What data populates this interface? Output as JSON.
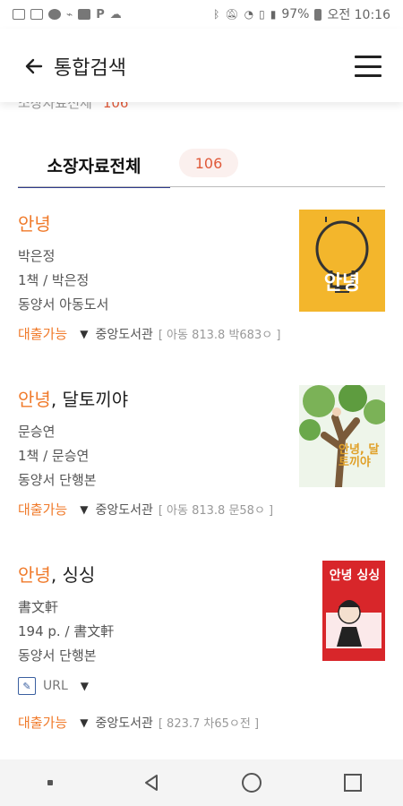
{
  "status_bar": {
    "battery": "97%",
    "time_label": "오전 10:16"
  },
  "app_bar": {
    "title": "통합검색",
    "back_icon": "arrow-left-icon",
    "menu_icon": "hamburger-menu-icon"
  },
  "peek_header": {
    "label": "소장자료전체",
    "count": "106"
  },
  "tabs": [
    {
      "label": "소장자료전체",
      "count": "106",
      "active": true
    }
  ],
  "books": [
    {
      "title_highlight": "안녕",
      "title_rest": "",
      "author": "박은정",
      "volume": "1책 / 박은정",
      "location_type": "동양서 아동도서",
      "availability": "대출가능",
      "library": "중앙도서관",
      "call_number": "[ 아동 813.8 박683ㅇ ]",
      "cover_text": "안녕"
    },
    {
      "title_highlight": "안녕",
      "title_rest": ", 달토끼야",
      "author": "문승연",
      "volume": "1책 / 문승연",
      "location_type": "동양서 단행본",
      "availability": "대출가능",
      "library": "중앙도서관",
      "call_number": "[ 아동 813.8 문58ㅇ ]",
      "cover_text": "안녕, 달토끼야"
    },
    {
      "title_highlight": "안녕",
      "title_rest": ", 싱싱",
      "author": "書文軒",
      "volume": "194 p. / 書文軒",
      "location_type": "동양서 단행본",
      "url_label": "URL",
      "availability": "대출가능",
      "library": "중앙도서관",
      "call_number": "[ 823.7 차65ㅇ전 ]",
      "cover_text": "안녕 싱싱"
    }
  ],
  "nav_bar": {
    "items": [
      "recent-apps-dot-icon",
      "back-triangle-icon",
      "home-circle-icon",
      "overview-square-icon"
    ]
  },
  "colors": {
    "accent_orange": "#f07a2a",
    "badge_red": "#e05a3a",
    "tab_underline": "#2e3a8c"
  }
}
